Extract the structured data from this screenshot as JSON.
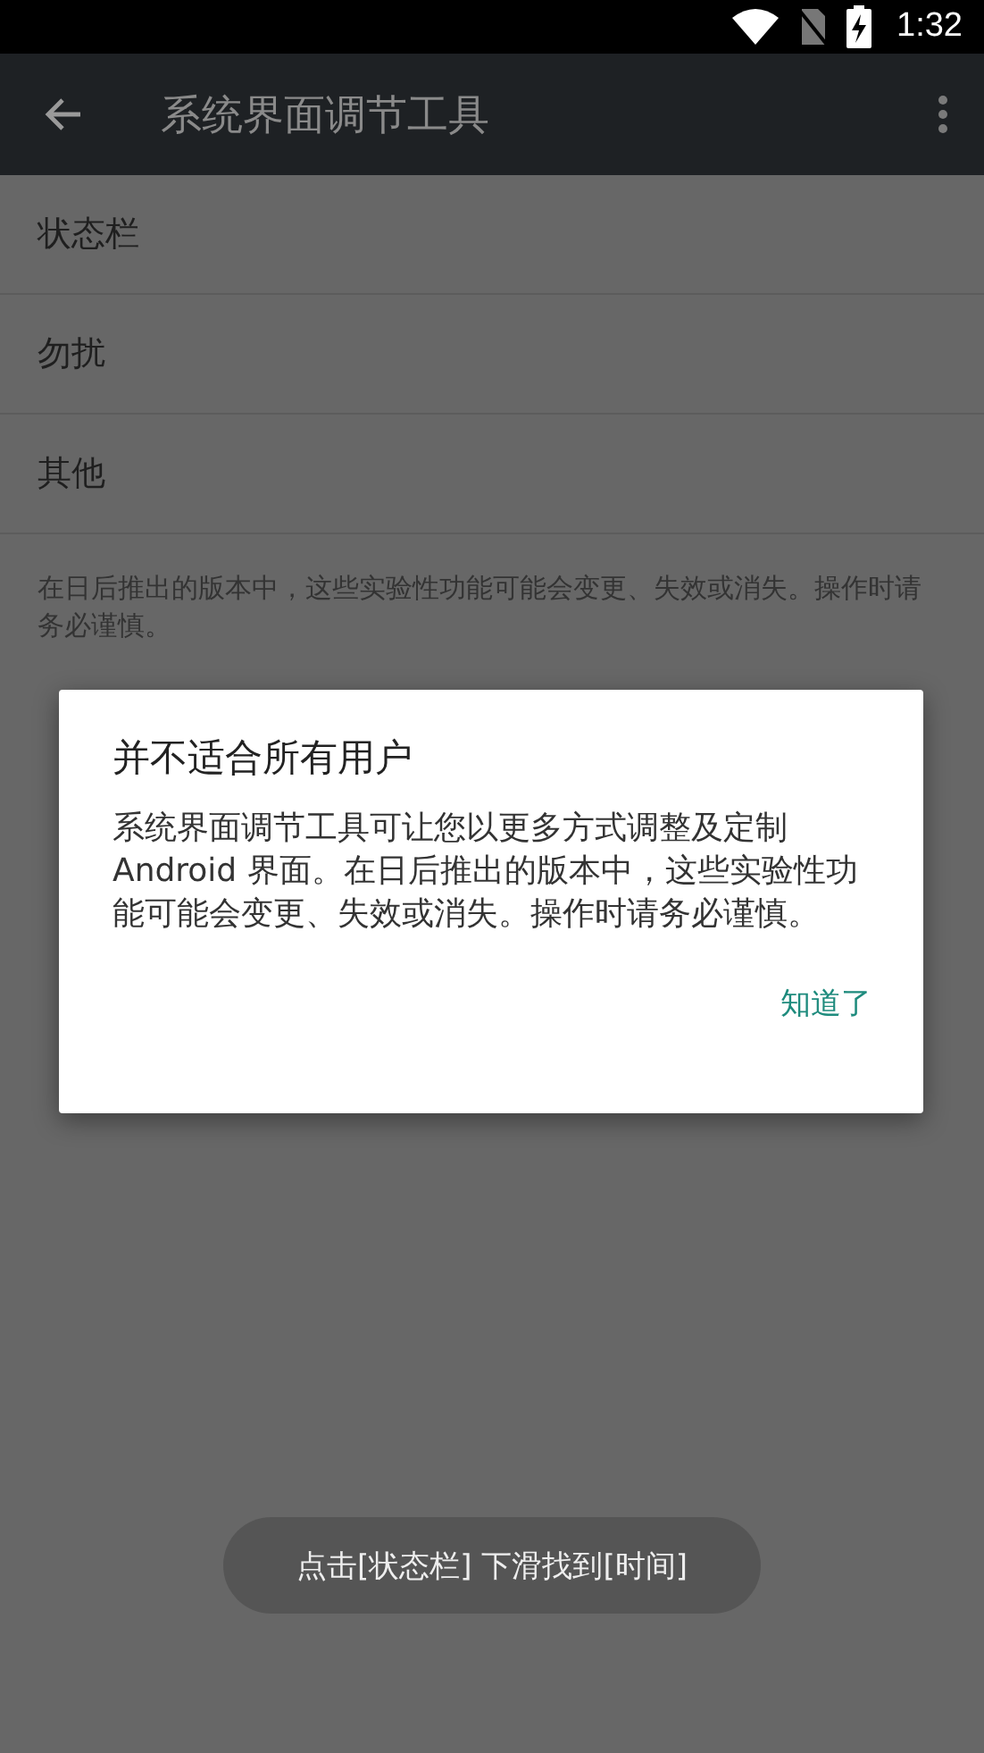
{
  "status_bar": {
    "time": "1:32"
  },
  "toolbar": {
    "title": "系统界面调节工具"
  },
  "items": [
    {
      "label": "状态栏"
    },
    {
      "label": "勿扰"
    },
    {
      "label": "其他"
    }
  ],
  "note": "在日后推出的版本中，这些实验性功能可能会变更、失效或消失。操作时请务必谨慎。",
  "dialog": {
    "title": "并不适合所有用户",
    "message": "系统界面调节工具可让您以更多方式调整及定制Android 界面。在日后推出的版本中，这些实验性功能可能会变更、失效或消失。操作时请务必谨慎。",
    "buttons": [
      "知道了"
    ]
  },
  "toast": "点击[状态栏] 下滑找到[时间]"
}
